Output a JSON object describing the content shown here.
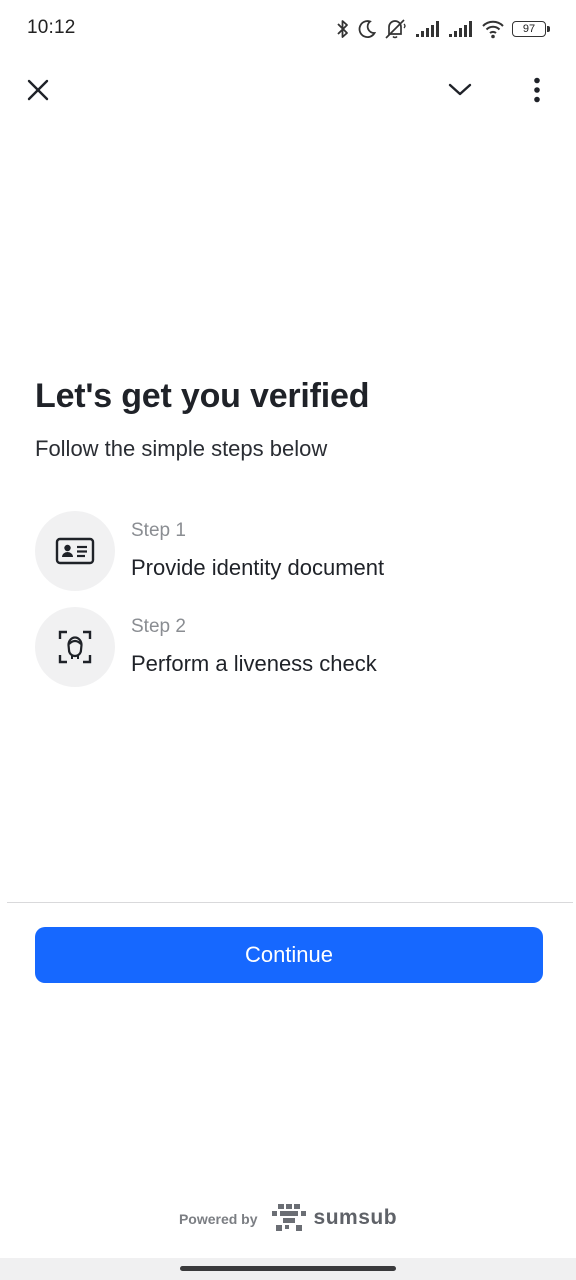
{
  "status_bar": {
    "time": "10:12",
    "battery": "97"
  },
  "top_bar": {
    "close_icon": "close-icon",
    "collapse_icon": "chevron-down-icon",
    "menu_icon": "more-vert-icon"
  },
  "content": {
    "title": "Let's get you verified",
    "subtitle": "Follow the simple steps below",
    "steps": [
      {
        "caption": "Step 1",
        "text": "Provide identity document",
        "icon": "id-card-icon"
      },
      {
        "caption": "Step 2",
        "text": "Perform a liveness check",
        "icon": "face-scan-icon"
      }
    ]
  },
  "actions": {
    "continue_label": "Continue"
  },
  "footer": {
    "powered_by": "Powered by",
    "brand": "sumsub"
  },
  "colors": {
    "primary": "#1668ff",
    "step_circle": "#f1f1f2",
    "caption": "#8a8d92"
  }
}
